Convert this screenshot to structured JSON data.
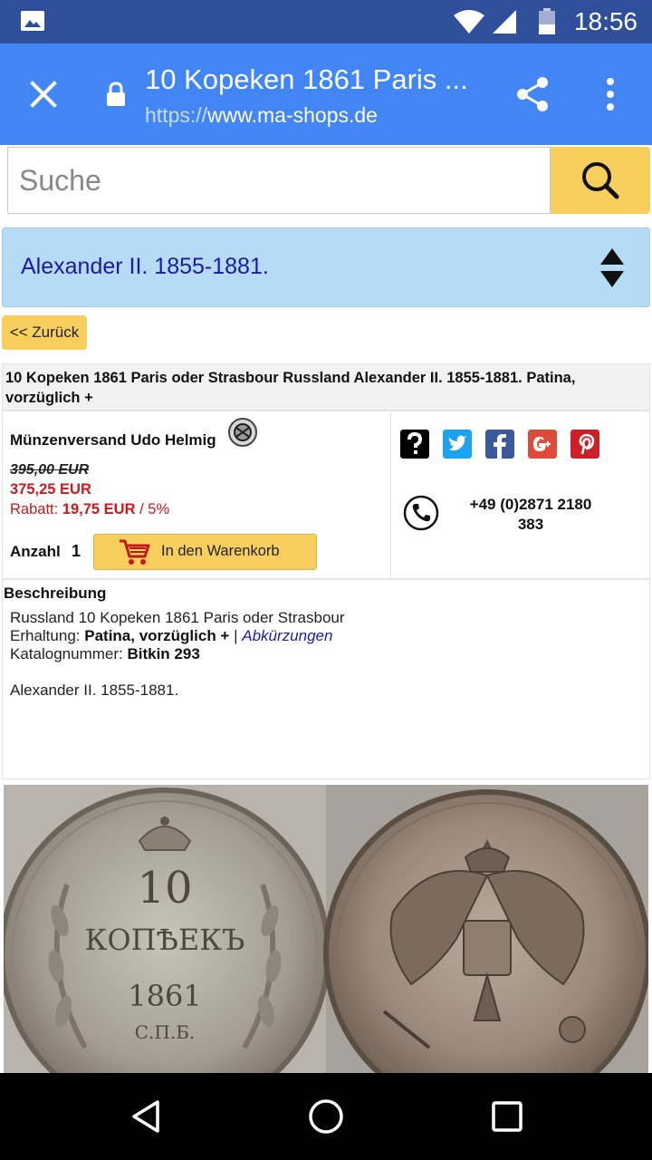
{
  "status_bar": {
    "time": "18:56",
    "icons": [
      "gallery-icon",
      "wifi-icon",
      "signal-icon",
      "battery-icon"
    ]
  },
  "toolbar": {
    "title": "10 Kopeken 1861 Paris ...",
    "url_scheme": "https://",
    "url_host": "www.ma-shops.de",
    "icons": [
      "close-icon",
      "lock-icon",
      "share-icon",
      "overflow-menu-icon"
    ]
  },
  "search": {
    "placeholder": "Suche",
    "button_icon": "search-icon"
  },
  "category": {
    "label": "Alexander II. 1855-1881.",
    "icon": "sort-arrows-icon"
  },
  "back_button": {
    "label": "<< Zurück"
  },
  "product": {
    "title": "10 Kopeken 1861 Paris oder Strasbour Russland Alexander II. 1855-1881. Patina, vorzüglich +",
    "seller": "Münzenversand Udo Helmig",
    "price_old": "395,00 EUR",
    "price_new": "375,25 EUR",
    "discount_label": "Rabatt:",
    "discount_amount": "19,75 EUR",
    "discount_percent": " / 5%",
    "quantity_label": "Anzahl",
    "quantity_value": "1",
    "cart_label": "In den Warenkorb",
    "phone": "+49 (0)2871 2180 383",
    "social": [
      {
        "name": "help-icon",
        "color": "#000000"
      },
      {
        "name": "twitter-icon",
        "color": "#1da1f2"
      },
      {
        "name": "facebook-icon",
        "color": "#3b5998"
      },
      {
        "name": "google-plus-icon",
        "color": "#dd4b39"
      },
      {
        "name": "pinterest-icon",
        "color": "#cb2027"
      }
    ]
  },
  "description": {
    "heading": "Beschreibung",
    "line1": "Russland 10 Kopeken 1861 Paris oder Strasbour",
    "condition_label": "Erhaltung:",
    "condition_value": "Patina, vorzüglich +",
    "separator": "|",
    "abbreviations_link": "Abkürzungen",
    "catalog_label": "Katalognummer:",
    "catalog_value": "Bitkin 293",
    "ruler": "Alexander II. 1855-1881."
  },
  "coin": {
    "obverse_denomination": "10",
    "obverse_word": "КОПѢЕКЪ",
    "obverse_year": "1861",
    "obverse_mint": "С.П.Б."
  },
  "colors": {
    "status_bar": "#2f4f9a",
    "toolbar": "#4285f4",
    "accent_yellow": "#f8cf5d",
    "category_bg": "#b6dcf5",
    "link": "#1a1aa8",
    "price_red": "#d0181c"
  }
}
